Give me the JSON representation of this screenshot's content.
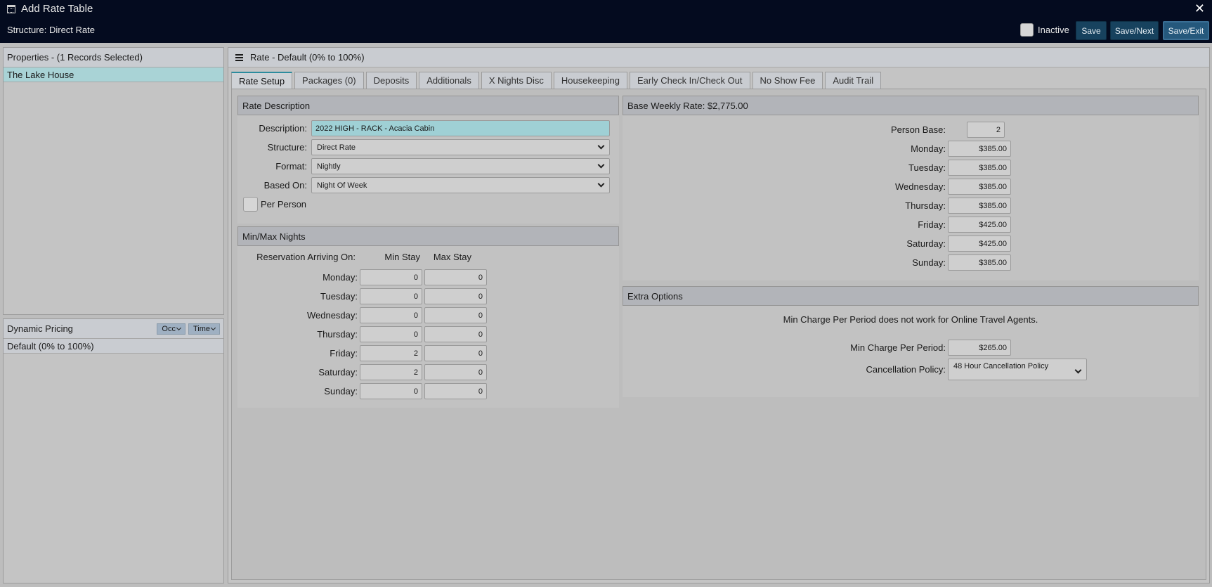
{
  "window": {
    "title": "Add Rate Table",
    "structure_label": "Structure: Direct Rate",
    "close_glyph": "✕"
  },
  "toolbar": {
    "inactive_label": "Inactive",
    "save_label": "Save",
    "save_next_label": "Save/Next",
    "save_exit_label": "Save/Exit"
  },
  "properties": {
    "header": "Properties - (1 Records Selected)",
    "items": [
      "The Lake House"
    ]
  },
  "dynamic_pricing": {
    "header": "Dynamic Pricing",
    "occ_label": "Occ",
    "time_label": "Time",
    "items": [
      "Default (0% to 100%)"
    ]
  },
  "rate": {
    "header": "Rate - Default (0% to 100%)",
    "tabs": [
      "Rate Setup",
      "Packages (0)",
      "Deposits",
      "Additionals",
      "X Nights Disc",
      "Housekeeping",
      "Early Check In/Check Out",
      "No Show Fee",
      "Audit Trail"
    ],
    "active_tab": "Rate Setup"
  },
  "rate_description": {
    "header": "Rate Description",
    "description_label": "Description:",
    "description_value": "2022 HIGH - RACK - Acacia Cabin",
    "structure_label": "Structure:",
    "structure_value": "Direct Rate",
    "format_label": "Format:",
    "format_value": "Nightly",
    "based_on_label": "Based On:",
    "based_on_value": "Night Of Week",
    "per_person_label": "Per Person"
  },
  "min_max": {
    "header": "Min/Max Nights",
    "arriving_label": "Reservation Arriving On:",
    "min_header": "Min Stay",
    "max_header": "Max Stay",
    "rows": [
      {
        "day": "Monday:",
        "min": "0",
        "max": "0"
      },
      {
        "day": "Tuesday:",
        "min": "0",
        "max": "0"
      },
      {
        "day": "Wednesday:",
        "min": "0",
        "max": "0"
      },
      {
        "day": "Thursday:",
        "min": "0",
        "max": "0"
      },
      {
        "day": "Friday:",
        "min": "2",
        "max": "0"
      },
      {
        "day": "Saturday:",
        "min": "2",
        "max": "0"
      },
      {
        "day": "Sunday:",
        "min": "0",
        "max": "0"
      }
    ]
  },
  "base_weekly": {
    "header": "Base Weekly Rate: $2,775.00",
    "person_base_label": "Person Base:",
    "person_base_value": "2",
    "rows": [
      {
        "day": "Monday:",
        "rate": "$385.00"
      },
      {
        "day": "Tuesday:",
        "rate": "$385.00"
      },
      {
        "day": "Wednesday:",
        "rate": "$385.00"
      },
      {
        "day": "Thursday:",
        "rate": "$385.00"
      },
      {
        "day": "Friday:",
        "rate": "$425.00"
      },
      {
        "day": "Saturday:",
        "rate": "$425.00"
      },
      {
        "day": "Sunday:",
        "rate": "$385.00"
      }
    ]
  },
  "extra_options": {
    "header": "Extra Options",
    "note": "Min Charge Per Period does not work for Online Travel Agents.",
    "min_charge_label": "Min Charge Per Period:",
    "min_charge_value": "$265.00",
    "cancellation_label": "Cancellation Policy:",
    "cancellation_value": "48 Hour Cancellation Policy"
  }
}
